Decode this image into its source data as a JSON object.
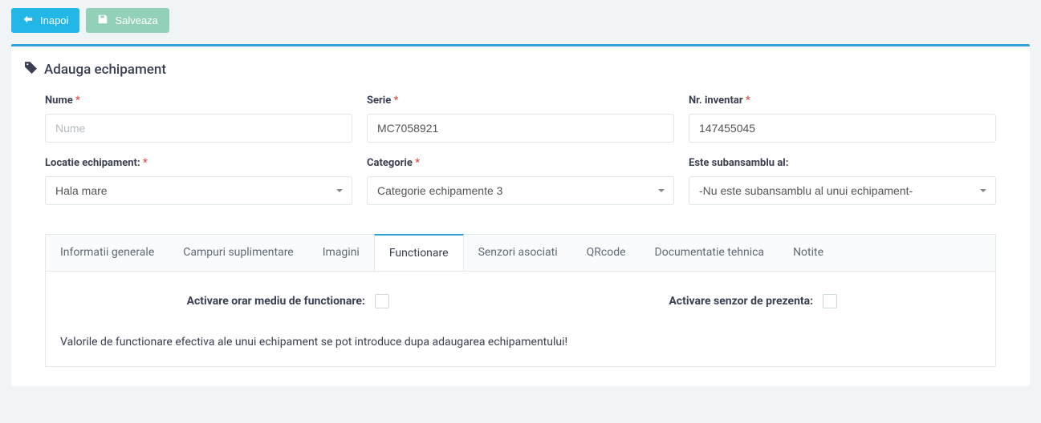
{
  "toolbar": {
    "back_label": "Inapoi",
    "save_label": "Salveaza"
  },
  "panel": {
    "title": "Adauga echipament"
  },
  "form": {
    "nume": {
      "label": "Nume",
      "placeholder": "Nume",
      "value": ""
    },
    "serie": {
      "label": "Serie",
      "placeholder": "",
      "value": "MC7058921"
    },
    "nr_inventar": {
      "label": "Nr. inventar",
      "placeholder": "",
      "value": "147455045"
    },
    "locatie": {
      "label": "Locatie echipament:",
      "value": "Hala mare"
    },
    "categorie": {
      "label": "Categorie",
      "value": "Categorie echipamente 3"
    },
    "subansamblu": {
      "label": "Este subansamblu al:",
      "value": "-Nu este subansamblu al unui echipament-"
    }
  },
  "tabs": {
    "items": [
      {
        "label": "Informatii generale"
      },
      {
        "label": "Campuri suplimentare"
      },
      {
        "label": "Imagini"
      },
      {
        "label": "Functionare"
      },
      {
        "label": "Senzori asociati"
      },
      {
        "label": "QRcode"
      },
      {
        "label": "Documentatie tehnica"
      },
      {
        "label": "Notite"
      }
    ],
    "active_index": 3
  },
  "functionare": {
    "activare_orar_label": "Activare orar mediu de functionare:",
    "activare_senzor_label": "Activare senzor de prezenta:",
    "info_text": "Valorile de functionare efectiva ale unui echipament se pot introduce dupa adaugarea echipamentului!"
  }
}
